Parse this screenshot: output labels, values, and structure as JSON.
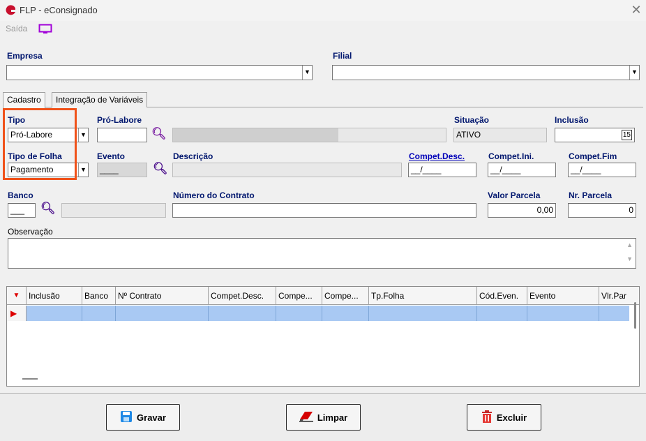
{
  "window": {
    "title": "FLP - eConsignado",
    "close_symbol": "✕"
  },
  "menu": {
    "saida_label": "Saída"
  },
  "empresa": {
    "label": "Empresa",
    "value": ""
  },
  "filial": {
    "label": "Filial",
    "value": ""
  },
  "tabs": [
    {
      "label": "Cadastro",
      "active": true
    },
    {
      "label": "Integração de Variáveis",
      "active": false
    }
  ],
  "form": {
    "tipo": {
      "label": "Tipo",
      "value": "Pró-Labore"
    },
    "pro_labore": {
      "label": "Pró-Labore",
      "code": "",
      "name": ""
    },
    "situacao": {
      "label": "Situação",
      "value": "ATIVO"
    },
    "inclusao": {
      "label": "Inclusão",
      "value": "",
      "calendar_text": "15"
    },
    "tipo_folha": {
      "label": "Tipo de Folha",
      "value": "Pagamento"
    },
    "evento": {
      "label": "Evento",
      "value": "____"
    },
    "descricao": {
      "label": "Descrição",
      "value": ""
    },
    "compet_desc": {
      "label": "Compet.Desc.",
      "value": "__/____"
    },
    "compet_ini": {
      "label": "Compet.Ini.",
      "value": "__/____"
    },
    "compet_fim": {
      "label": "Compet.Fim",
      "value": "__/____"
    },
    "banco": {
      "label": "Banco",
      "value": "___",
      "name": ""
    },
    "numero_contrato": {
      "label": "Número do Contrato",
      "value": ""
    },
    "valor_parcela": {
      "label": "Valor Parcela",
      "value": "0,00"
    },
    "nr_parcela": {
      "label": "Nr. Parcela",
      "value": "0"
    },
    "observacao": {
      "label": "Observação",
      "value": ""
    }
  },
  "grid": {
    "columns": [
      "Inclusão",
      "Banco",
      "Nº Contrato",
      "Compet.Desc.",
      "Compe...",
      "Compe...",
      "Tp.Folha",
      "Cód.Even.",
      "Evento",
      "Vlr.Par"
    ]
  },
  "buttons": {
    "gravar": "Gravar",
    "limpar": "Limpar",
    "excluir": "Excluir"
  },
  "colors": {
    "label_blue": "#00166e",
    "highlight": "#f0521a",
    "icon_purple": "#7a1fa2",
    "row_selected": "#a9c9f3"
  }
}
